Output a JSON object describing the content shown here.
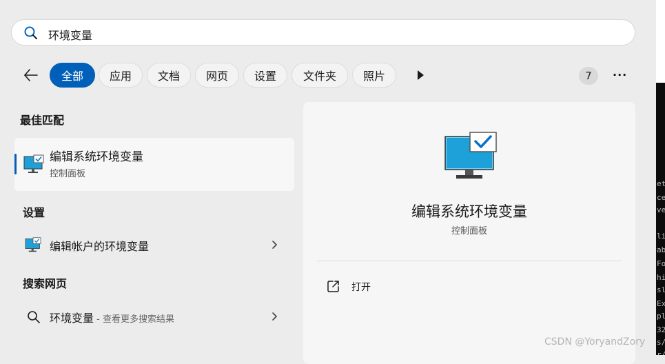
{
  "search": {
    "query": "环境变量"
  },
  "filters": {
    "tabs": [
      {
        "label": "全部",
        "active": true
      },
      {
        "label": "应用"
      },
      {
        "label": "文档"
      },
      {
        "label": "网页"
      },
      {
        "label": "设置"
      },
      {
        "label": "文件夹"
      },
      {
        "label": "照片"
      }
    ],
    "badge_count": "7",
    "more_label": "···"
  },
  "results": {
    "best_match_heading": "最佳匹配",
    "best_match": {
      "title": "编辑系统环境变量",
      "subtitle": "控制面板",
      "icon": "monitor-check-icon"
    },
    "settings_heading": "设置",
    "settings_item": {
      "title": "编辑帐户的环境变量",
      "icon": "monitor-check-icon"
    },
    "web_heading": "搜索网页",
    "web_item": {
      "title": "环境变量",
      "hint": " - 查看更多搜索结果",
      "icon": "search-icon"
    }
  },
  "detail": {
    "title": "编辑系统环境变量",
    "subtitle": "控制面板",
    "actions": [
      {
        "label": "打开",
        "icon": "open-external-icon"
      }
    ]
  },
  "watermark": "CSDN @YoryandZory",
  "terminal_fragments": [
    "et",
    "ce",
    "ve",
    "li",
    "ab",
    "Fo",
    "hi",
    "sl",
    "Ex",
    "pl",
    "32",
    "s/",
    "r/"
  ],
  "colors": {
    "accent": "#005fb8",
    "panel_bg": "#ececec",
    "card_bg": "#f6f6f6"
  }
}
